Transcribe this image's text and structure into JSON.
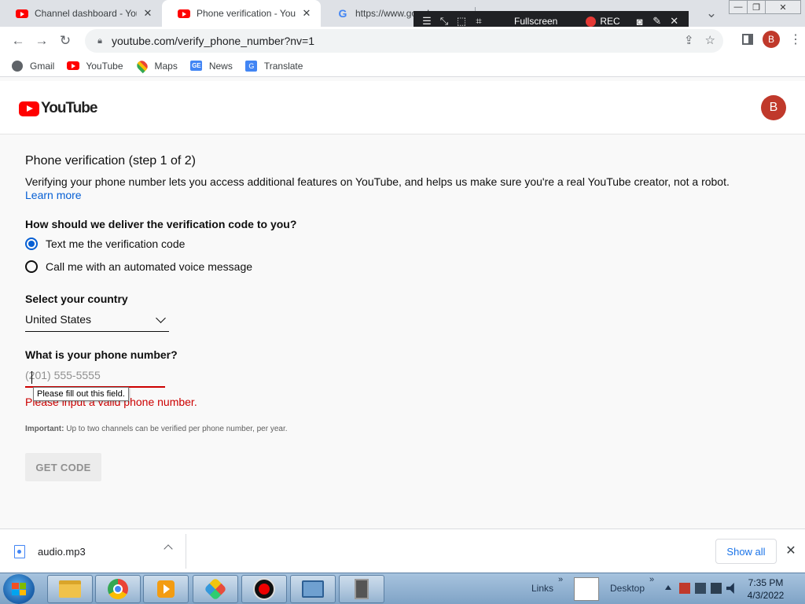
{
  "browser": {
    "tabs": [
      {
        "title": "Channel dashboard - YouTube",
        "favicon": "youtube-icon",
        "active": false
      },
      {
        "title": "Phone verification - YouTube",
        "favicon": "youtube-icon",
        "active": true
      },
      {
        "title": "https://www.google.com",
        "favicon": "google-icon",
        "active": false
      }
    ],
    "recording_toolbar": {
      "fullscreen_label": "Fullscreen",
      "rec_label": "REC"
    },
    "url": "youtube.com/verify_phone_number?nv=1",
    "profile_initial": "B",
    "bookmarks": [
      {
        "label": "Gmail",
        "icon": "globe-icon"
      },
      {
        "label": "YouTube",
        "icon": "youtube-icon"
      },
      {
        "label": "Maps",
        "icon": "maps-pin-icon"
      },
      {
        "label": "News",
        "icon": "news-icon"
      },
      {
        "label": "Translate",
        "icon": "translate-icon"
      }
    ]
  },
  "youtube": {
    "logo_text": "YouTube",
    "avatar_initial": "B"
  },
  "form": {
    "title": "Phone verification (step 1 of 2)",
    "description": "Verifying your phone number lets you access additional features on YouTube, and helps us make sure you're a real YouTube creator, not a robot.",
    "learn_more": "Learn more",
    "delivery_question": "How should we deliver the verification code to you?",
    "delivery_options": [
      {
        "label": "Text me the verification code",
        "selected": true
      },
      {
        "label": "Call me with an automated voice message",
        "selected": false
      }
    ],
    "country_label": "Select your country",
    "country_value": "United States",
    "phone_label": "What is your phone number?",
    "phone_value": "",
    "phone_placeholder": "(201) 555-5555",
    "tooltip": "Please fill out this field.",
    "error": "Please input a valid phone number.",
    "important_label": "Important:",
    "important_text": "Up to two channels can be verified per phone number, per year.",
    "get_code": "GET CODE"
  },
  "downloads": {
    "file_name": "audio.mp3",
    "show_all": "Show all"
  },
  "taskbar": {
    "links_label": "Links",
    "desktop_label": "Desktop",
    "time": "7:35 PM",
    "date": "4/3/2022"
  },
  "colors": {
    "youtube_red": "#ff0000",
    "link_blue": "#065fd4",
    "error_red": "#cc0000",
    "avatar_bg": "#c0392b"
  }
}
